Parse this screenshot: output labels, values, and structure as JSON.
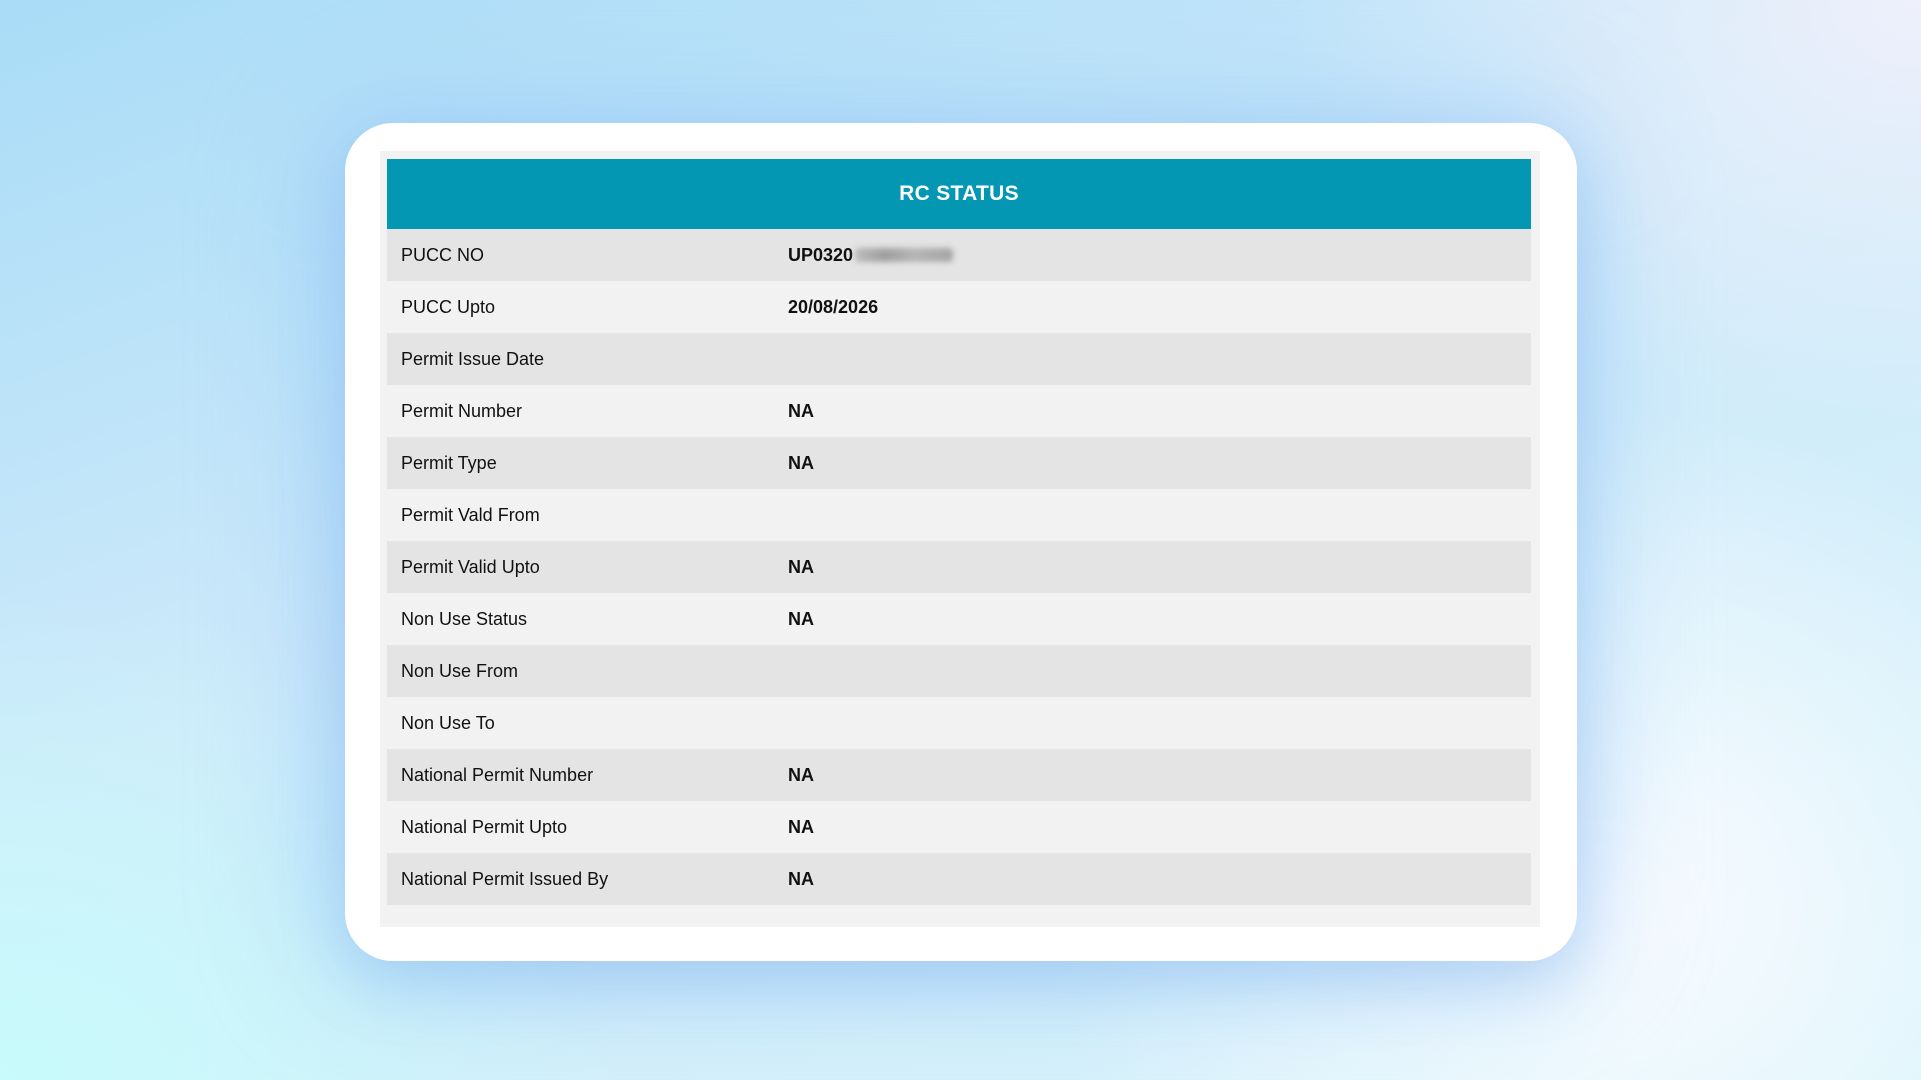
{
  "card": {
    "title": "RC STATUS"
  },
  "rows": [
    {
      "label": "PUCC NO",
      "value": "UP0320",
      "redacted": true
    },
    {
      "label": "PUCC Upto",
      "value": "20/08/2026"
    },
    {
      "label": "Permit Issue Date",
      "value": ""
    },
    {
      "label": "Permit Number",
      "value": "NA"
    },
    {
      "label": "Permit Type",
      "value": "NA"
    },
    {
      "label": "Permit Vald From",
      "value": ""
    },
    {
      "label": "Permit Valid Upto",
      "value": "NA"
    },
    {
      "label": "Non Use Status",
      "value": "NA"
    },
    {
      "label": "Non Use From",
      "value": ""
    },
    {
      "label": "Non Use To",
      "value": ""
    },
    {
      "label": "National Permit Number",
      "value": "NA"
    },
    {
      "label": "National Permit Upto",
      "value": "NA"
    },
    {
      "label": "National Permit Issued By",
      "value": "NA"
    }
  ],
  "colors": {
    "header": "#0397b4",
    "row_odd": "#e4e4e4",
    "row_even": "#f2f2f2"
  }
}
